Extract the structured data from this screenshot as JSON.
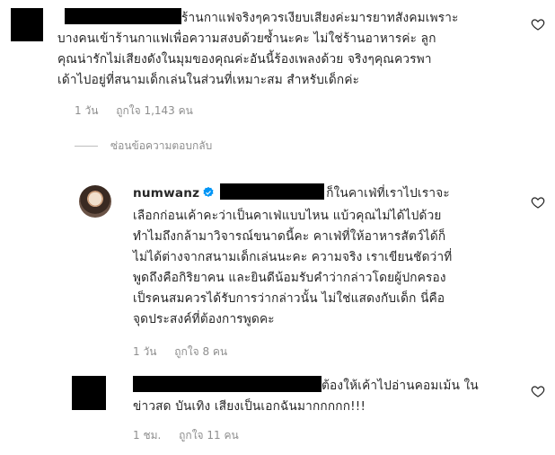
{
  "comments": [
    {
      "username_redacted": true,
      "lines": [
        "ร้านกาแฟจริงๆควรเงียบเสียงค่ะมารยาทสังคมเพราะ",
        "บางคนเข้าร้านกาแฟเพื่อความสงบด้วยซ้ำนะคะ ไม่ใช่ร้านอาหารค่ะ ลูก",
        "คุณน่ารักไม่เสียงดังในมุมของคุณค่ะอันนี้ร้องเพลงด้วย จริงๆคุณควรพา",
        "เด้าไปอยู่ที่สนามเด็กเล่นในส่วนที่เหมาะสม สำหรับเด็กค่ะ"
      ],
      "time": "1 วัน",
      "likes": "ถูกใจ 1,143 คน"
    },
    {
      "username": "numwanz",
      "verified": true,
      "lines": [
        "ก็ในคาเฟ่ที่เราไปเราจะ",
        "เลือกก่อนเค้าคะว่าเป็นคาเฟ่แบบไหน แบ้วคุณไม่ได้ไปด้วย",
        "ทำไมถึงกล้ามาวิจารณ์ขนาดนี้คะ คาเฟ่ที่ให้อาหารสัตว์ได้ก็",
        "ไม่ได้ต่างจากสนามเด็กเล่นนะคะ ความจริง เราเขียนชัดว่าที่",
        "พูดถึงคือกิริยาคน และยินดีน้อมรับคำว่ากล่าวโดยผู้ปกครอง",
        "เป็รคนสมควรได้รับการว่ากล่าวนั้น ไม่ใช่แสดงกับเด็ก นี่คือ",
        "จุดประสงค์ที่ต้องการพูดคะ"
      ],
      "time": "1 วัน",
      "likes": "ถูกใจ 8 คน"
    },
    {
      "username_redacted": true,
      "lines": [
        "ต้องให้เค้าไปอ่านคอมเม้น ใน",
        "ข่าวสด บันเทิง เสียงเป็นเอกฉันมากกกกก!!!"
      ],
      "time": "1 ชม.",
      "likes": "ถูกใจ 11 คน"
    }
  ],
  "replies_toggle": "ซ่อนข้อความตอบกลับ",
  "icons": {
    "like": "heart-outline-icon",
    "verified": "verified-badge-icon"
  },
  "colors": {
    "verified": "#0095f6",
    "meta": "#8e8e8e",
    "text": "#262626"
  }
}
